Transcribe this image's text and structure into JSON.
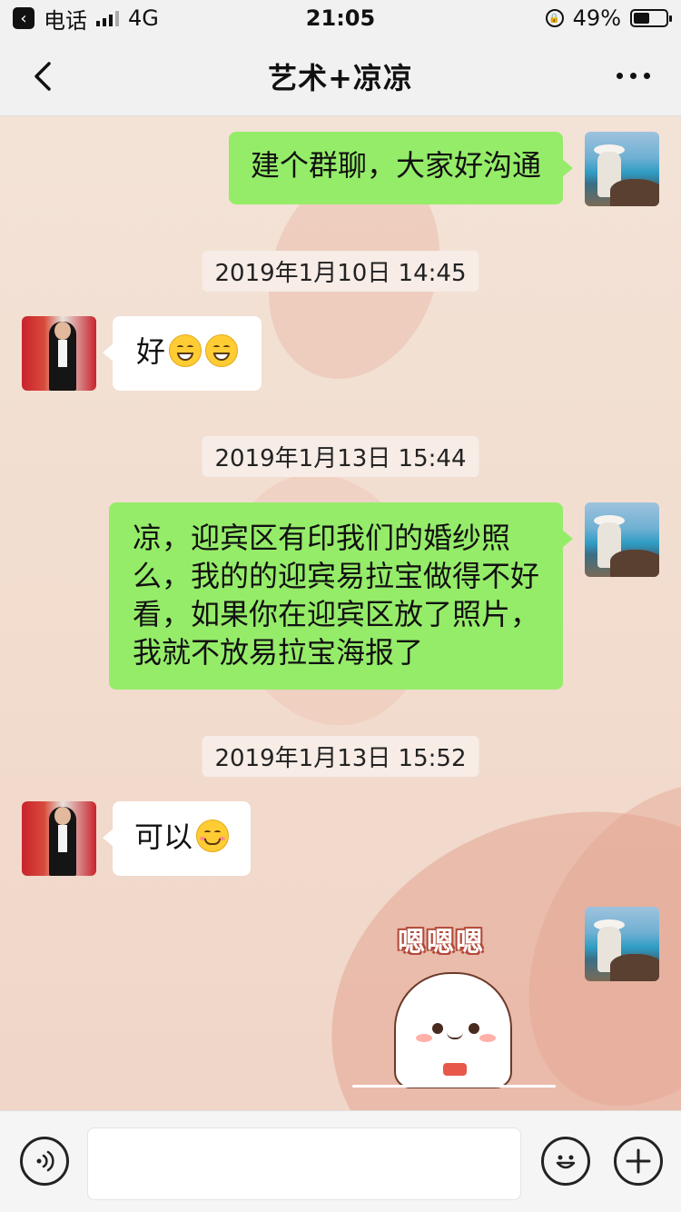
{
  "status_bar": {
    "carrier": "电话",
    "network": "4G",
    "time": "21:05",
    "battery": "49%",
    "battery_level": 0.49
  },
  "nav": {
    "title": "艺术+凉凉",
    "back_icon": "chevron-left-icon",
    "more_icon": "more-dots-icon"
  },
  "messages": [
    {
      "side": "me",
      "text": "建个群聊，大家好沟通"
    },
    {
      "type": "timestamp",
      "text": "2019年1月10日 14:45"
    },
    {
      "side": "other",
      "text": "好",
      "emojis": [
        "grin-emoji",
        "grin-emoji"
      ]
    },
    {
      "type": "timestamp",
      "text": "2019年1月13日 15:44"
    },
    {
      "side": "me",
      "text": "凉，迎宾区有印我们的婚纱照么，我的的迎宾易拉宝做得不好看，如果你在迎宾区放了照片，我就不放易拉宝海报了"
    },
    {
      "type": "timestamp",
      "text": "2019年1月13日 15:52"
    },
    {
      "side": "other",
      "text": "可以",
      "emojis": [
        "smile-emoji"
      ]
    },
    {
      "side": "me",
      "type": "sticker",
      "text": "嗯嗯嗯"
    }
  ],
  "input_bar": {
    "value": "",
    "voice_icon": "voice-icon",
    "emoji_icon": "emoji-icon",
    "plus_icon": "plus-icon"
  },
  "colors": {
    "my_bubble": "#95ec69",
    "other_bubble": "#ffffff",
    "nav_bg": "#f2f1f1"
  }
}
